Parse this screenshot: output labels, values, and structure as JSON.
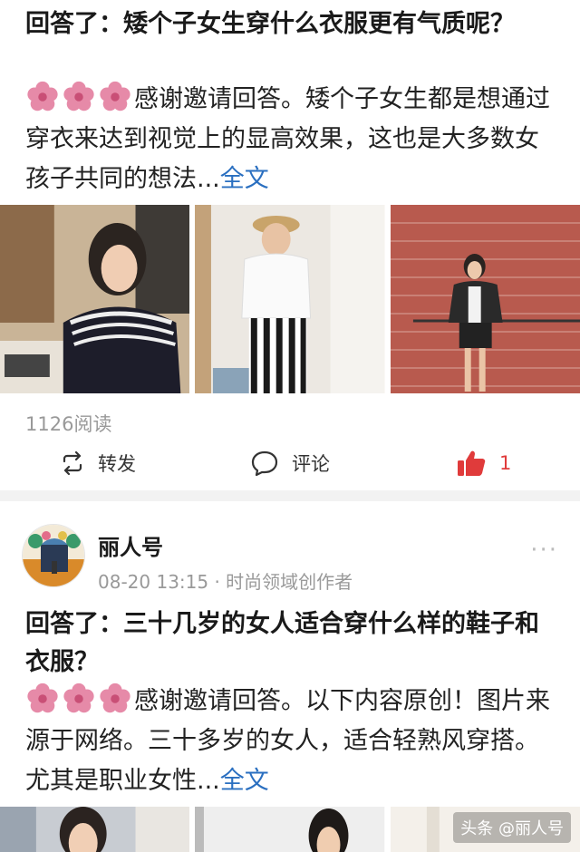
{
  "post1": {
    "title": "回答了：矮个子女生穿什么衣服更有气质呢？",
    "excerpt": "感谢邀请回答。矮个子女生都是想通过穿衣来达到视觉上的显高效果，这也是大多数女孩子共同的想法...",
    "full_link": "全文",
    "reads": "1126阅读",
    "actions": {
      "repost": "转发",
      "comment": "评论",
      "like_count": "1"
    }
  },
  "post2": {
    "author": "丽人号",
    "meta": "08-20 13:15 · 时尚领域创作者",
    "more": "···",
    "title": "回答了：三十几岁的女人适合穿什么样的鞋子和衣服？",
    "excerpt": "感谢邀请回答。以下内容原创！图片来源于网络。三十多岁的女人，适合轻熟风穿搭。尤其是职业女性...",
    "full_link": "全文"
  },
  "watermark": "头条 @丽人号",
  "colors": {
    "link": "#2a6fc0",
    "like": "#e03b3b",
    "flower": "#e68aa8",
    "muted": "#999999"
  }
}
